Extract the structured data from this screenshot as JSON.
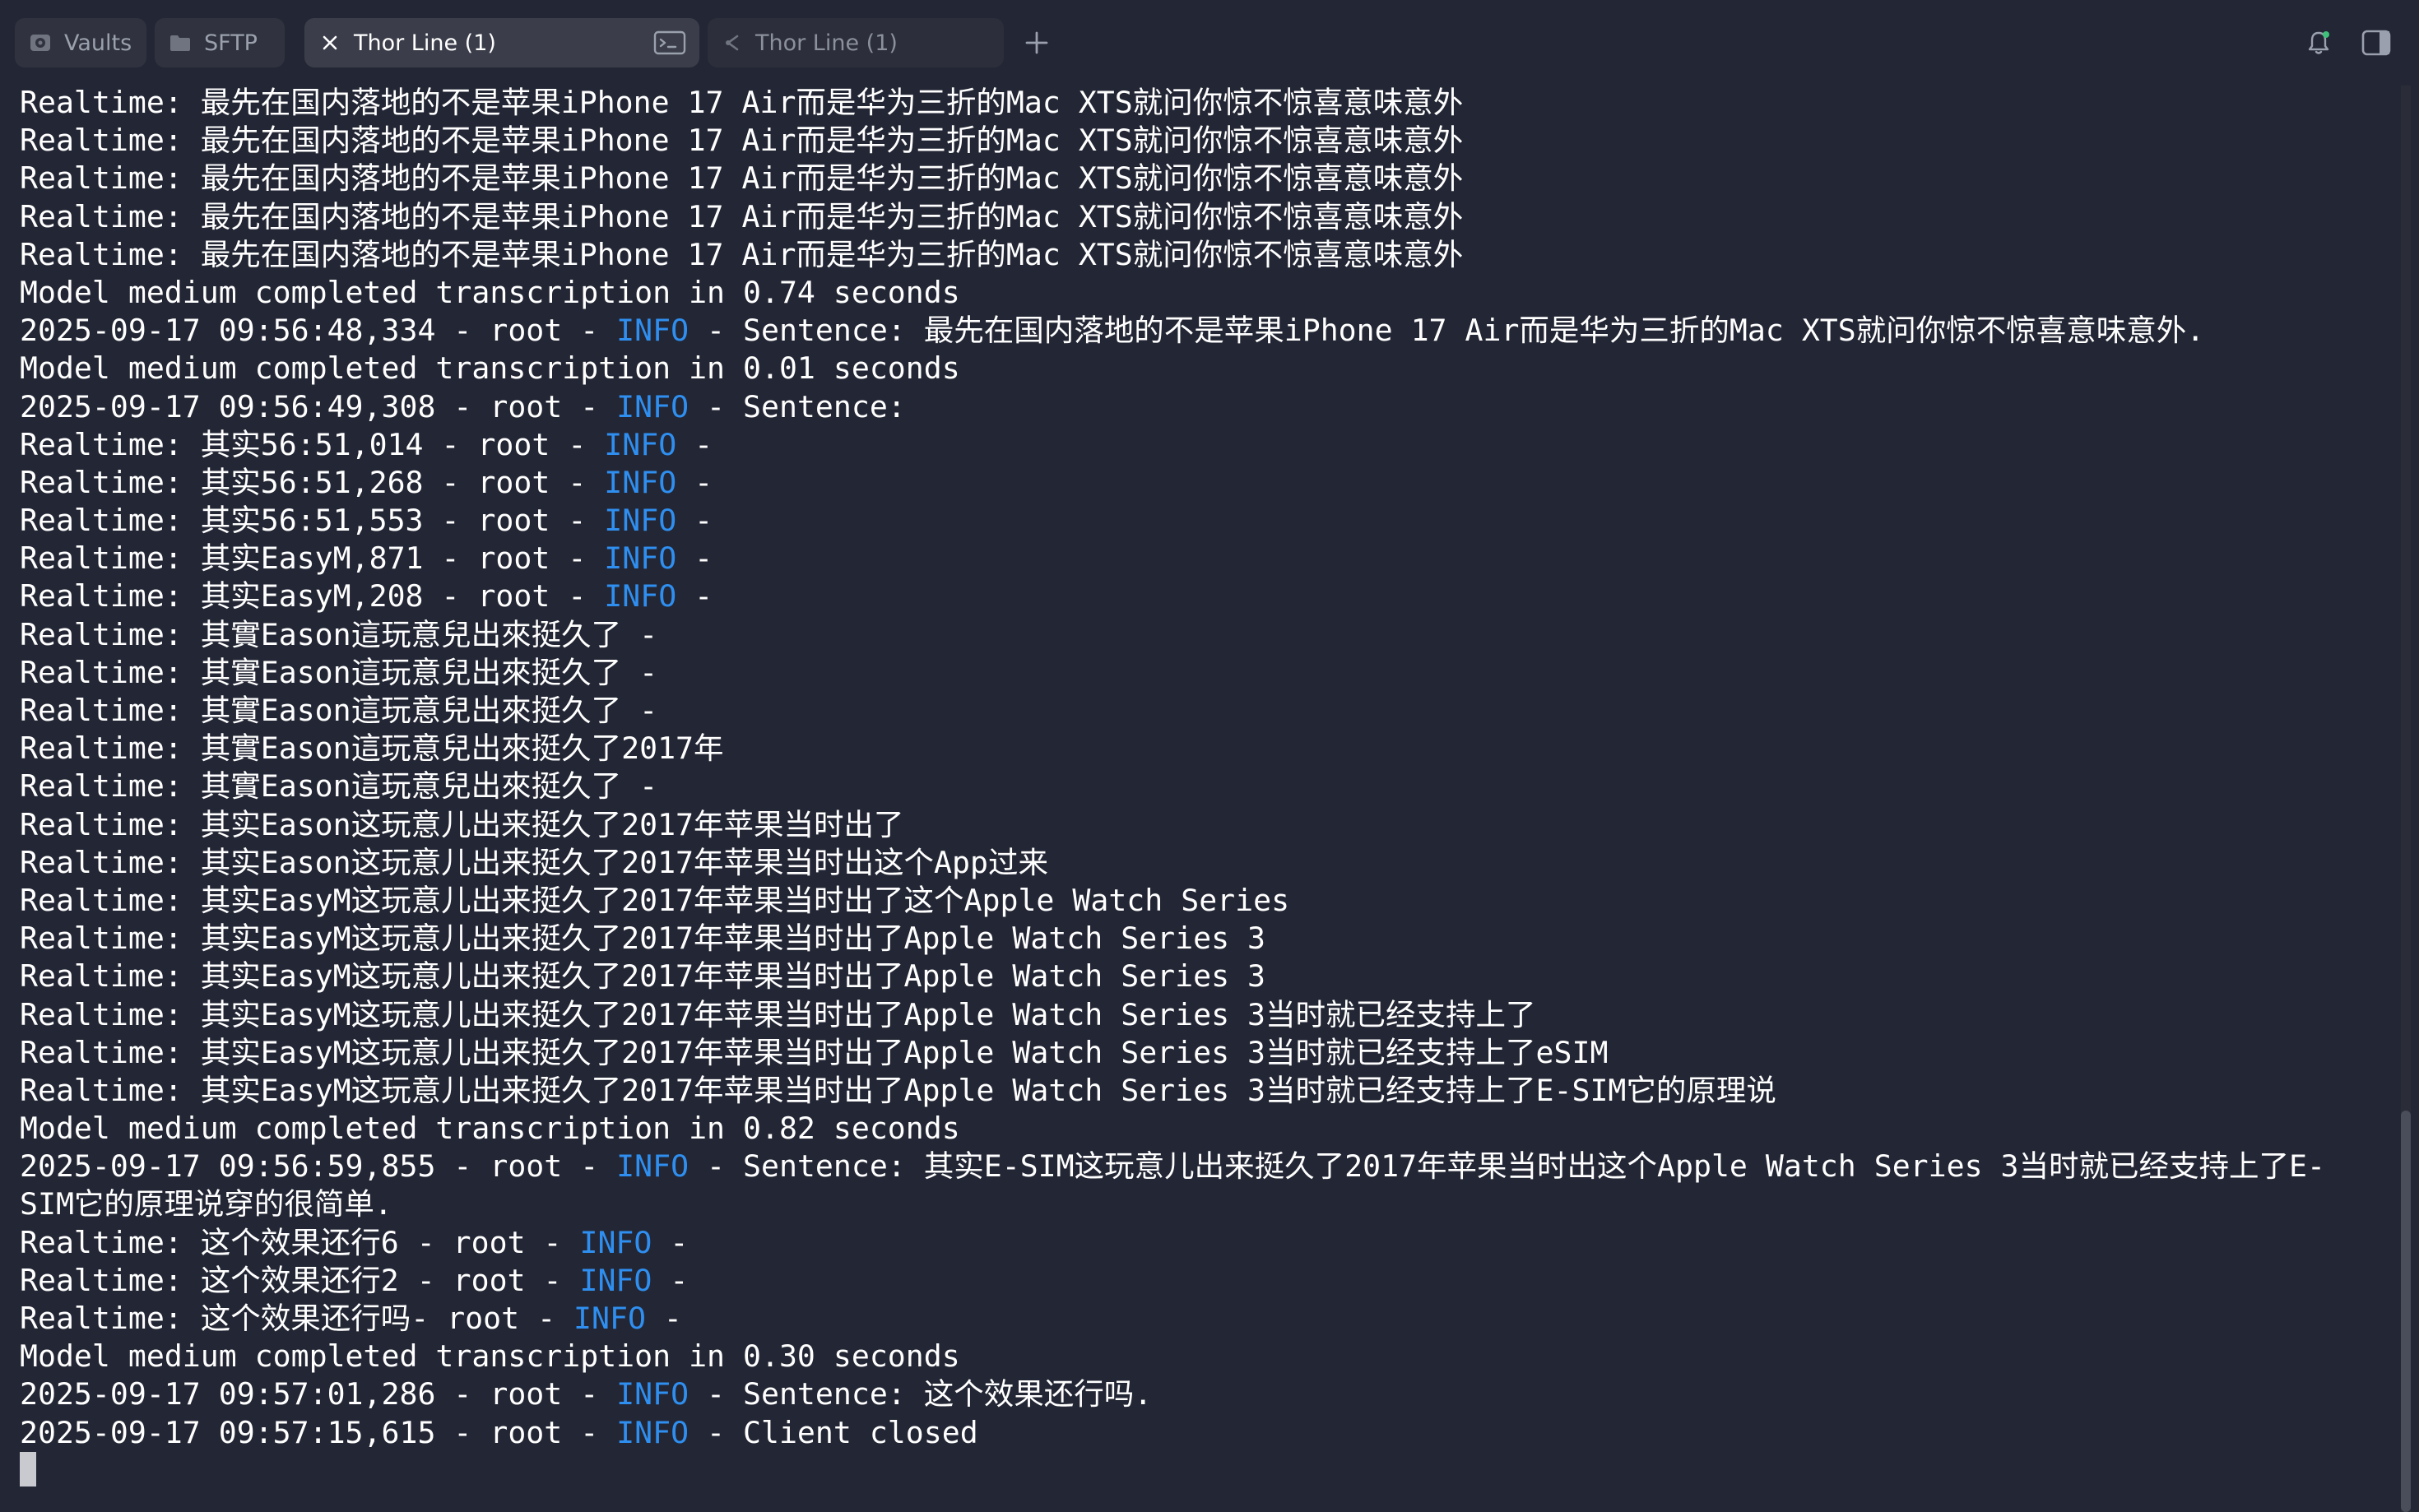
{
  "tabs": [
    {
      "label": "Vaults",
      "icon": "vault-icon"
    },
    {
      "label": "SFTP",
      "icon": "folder-icon"
    },
    {
      "label": "Thor Line (1)",
      "icon": "close-icon",
      "active": true
    },
    {
      "label": "Thor Line (1)",
      "icon": "ssh-icon"
    }
  ],
  "colors": {
    "background": "#232634",
    "info": "#2f8ff0",
    "text": "#ffffff"
  },
  "terminal": {
    "lines": [
      {
        "pre": "Realtime: 最先在国内落地的不是苹果iPhone 17 Air而是华为三折的Mac XTS就问你惊不惊喜意味意外"
      },
      {
        "pre": "Realtime: 最先在国内落地的不是苹果iPhone 17 Air而是华为三折的Mac XTS就问你惊不惊喜意味意外"
      },
      {
        "pre": "Realtime: 最先在国内落地的不是苹果iPhone 17 Air而是华为三折的Mac XTS就问你惊不惊喜意味意外"
      },
      {
        "pre": "Realtime: 最先在国内落地的不是苹果iPhone 17 Air而是华为三折的Mac XTS就问你惊不惊喜意味意外"
      },
      {
        "pre": "Realtime: 最先在国内落地的不是苹果iPhone 17 Air而是华为三折的Mac XTS就问你惊不惊喜意味意外"
      },
      {
        "pre": "Model medium completed transcription in 0.74 seconds"
      },
      {
        "pre": "2025-09-17 09:56:48,334 - root - ",
        "level": "INFO",
        "post": " - Sentence: 最先在国内落地的不是苹果iPhone 17 Air而是华为三折的Mac XTS就问你惊不惊喜意味意外."
      },
      {
        "pre": "Model medium completed transcription in 0.01 seconds"
      },
      {
        "pre": "2025-09-17 09:56:49,308 - root - ",
        "level": "INFO",
        "post": " - Sentence:"
      },
      {
        "pre": "Realtime: 其实56:51,014 - root - ",
        "level": "INFO",
        "post": " -"
      },
      {
        "pre": "Realtime: 其实56:51,268 - root - ",
        "level": "INFO",
        "post": " -"
      },
      {
        "pre": "Realtime: 其实56:51,553 - root - ",
        "level": "INFO",
        "post": " -"
      },
      {
        "pre": "Realtime: 其实EasyM,871 - root - ",
        "level": "INFO",
        "post": " -"
      },
      {
        "pre": "Realtime: 其实EasyM,208 - root - ",
        "level": "INFO",
        "post": " -"
      },
      {
        "pre": "Realtime: 其實Eason這玩意兒出來挺久了 -"
      },
      {
        "pre": "Realtime: 其實Eason這玩意兒出來挺久了 -"
      },
      {
        "pre": "Realtime: 其實Eason這玩意兒出來挺久了 -"
      },
      {
        "pre": "Realtime: 其實Eason這玩意兒出來挺久了2017年"
      },
      {
        "pre": "Realtime: 其實Eason這玩意兒出來挺久了 -"
      },
      {
        "pre": "Realtime: 其实Eason这玩意儿出来挺久了2017年苹果当时出了"
      },
      {
        "pre": "Realtime: 其实Eason这玩意儿出来挺久了2017年苹果当时出这个App过来"
      },
      {
        "pre": "Realtime: 其实EasyM这玩意儿出来挺久了2017年苹果当时出了这个Apple Watch Series"
      },
      {
        "pre": "Realtime: 其实EasyM这玩意儿出来挺久了2017年苹果当时出了Apple Watch Series 3"
      },
      {
        "pre": "Realtime: 其实EasyM这玩意儿出来挺久了2017年苹果当时出了Apple Watch Series 3"
      },
      {
        "pre": "Realtime: 其实EasyM这玩意儿出来挺久了2017年苹果当时出了Apple Watch Series 3当时就已经支持上了"
      },
      {
        "pre": "Realtime: 其实EasyM这玩意儿出来挺久了2017年苹果当时出了Apple Watch Series 3当时就已经支持上了eSIM"
      },
      {
        "pre": "Realtime: 其实EasyM这玩意儿出来挺久了2017年苹果当时出了Apple Watch Series 3当时就已经支持上了E-SIM它的原理说"
      },
      {
        "pre": "Model medium completed transcription in 0.82 seconds"
      },
      {
        "pre": "2025-09-17 09:56:59,855 - root - ",
        "level": "INFO",
        "post": " - Sentence: 其实E-SIM这玩意儿出来挺久了2017年苹果当时出这个Apple Watch Series 3当时就已经支持上了E-"
      },
      {
        "pre": "SIM它的原理说穿的很简单."
      },
      {
        "pre": "Realtime: 这个效果还行6 - root - ",
        "level": "INFO",
        "post": " -"
      },
      {
        "pre": "Realtime: 这个效果还行2 - root - ",
        "level": "INFO",
        "post": " -"
      },
      {
        "pre": "Realtime: 这个效果还行吗- root - ",
        "level": "INFO",
        "post": " -"
      },
      {
        "pre": "Model medium completed transcription in 0.30 seconds"
      },
      {
        "pre": "2025-09-17 09:57:01,286 - root - ",
        "level": "INFO",
        "post": " - Sentence: 这个效果还行吗."
      },
      {
        "pre": "2025-09-17 09:57:15,615 - root - ",
        "level": "INFO",
        "post": " - Client closed"
      }
    ]
  }
}
